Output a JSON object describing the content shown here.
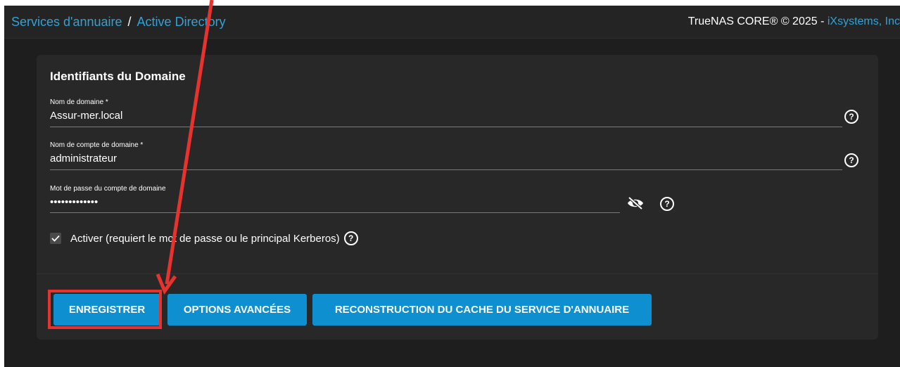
{
  "breadcrumb": {
    "parent": "Services d'annuaire",
    "separator": "/",
    "current": "Active Directory"
  },
  "copyright": {
    "text": "TrueNAS CORE® © 2025 - ",
    "brand": "iXsystems, Inc"
  },
  "form": {
    "title": "Identifiants du Domaine",
    "domain_name": {
      "label": "Nom de domaine *",
      "value": "Assur-mer.local"
    },
    "account_name": {
      "label": "Nom de compte de domaine *",
      "value": "administrateur"
    },
    "password": {
      "label": "Mot de passe du compte de domaine",
      "value": "•••••••••••••"
    },
    "enable": {
      "label": "Activer (requiert le mot de passe ou le principal Kerberos)",
      "checked": true
    }
  },
  "buttons": {
    "save": "ENREGISTRER",
    "advanced": "OPTIONS AVANCÉES",
    "rebuild_cache": "RECONSTRUCTION DU CACHE DU SERVICE D'ANNUAIRE"
  },
  "icons": {
    "help": "help-circle-icon",
    "visibility": "eye-off-icon",
    "check": "checkmark-icon"
  },
  "colors": {
    "accent": "#0d8fd0",
    "link": "#2ea3d8",
    "annotation": "#e8322e"
  }
}
